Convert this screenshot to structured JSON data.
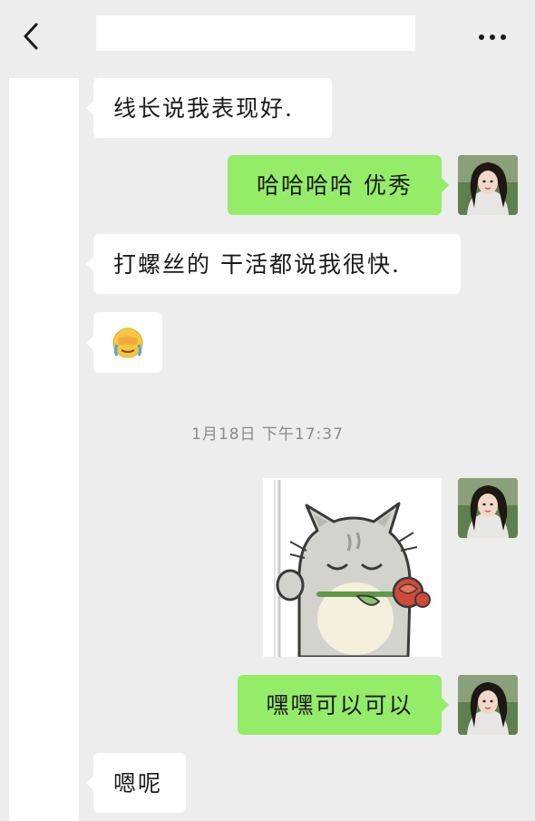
{
  "header": {
    "back_icon": "chevron-left-icon",
    "more_icon": "more-dots-icon",
    "title": ""
  },
  "messages": [
    {
      "side": "in",
      "text": "线长说我表现好."
    },
    {
      "side": "out",
      "text": "哈哈哈哈 优秀"
    },
    {
      "side": "in",
      "text": "打螺丝的 干活都说我很快."
    },
    {
      "side": "in",
      "emoji": "😭",
      "emoji_name": "facepalm-cry-emoji"
    },
    {
      "timestamp": "1月18日 下午17:37"
    },
    {
      "side": "out",
      "sticker": "cat-holding-rose-sticker"
    },
    {
      "side": "out",
      "text": "嘿嘿可以可以"
    },
    {
      "side": "in",
      "text": "嗯呢"
    }
  ],
  "colors": {
    "background": "#ededed",
    "bubble_in": "#ffffff",
    "bubble_out": "#95ec69",
    "timestamp": "#8a8a8a"
  }
}
